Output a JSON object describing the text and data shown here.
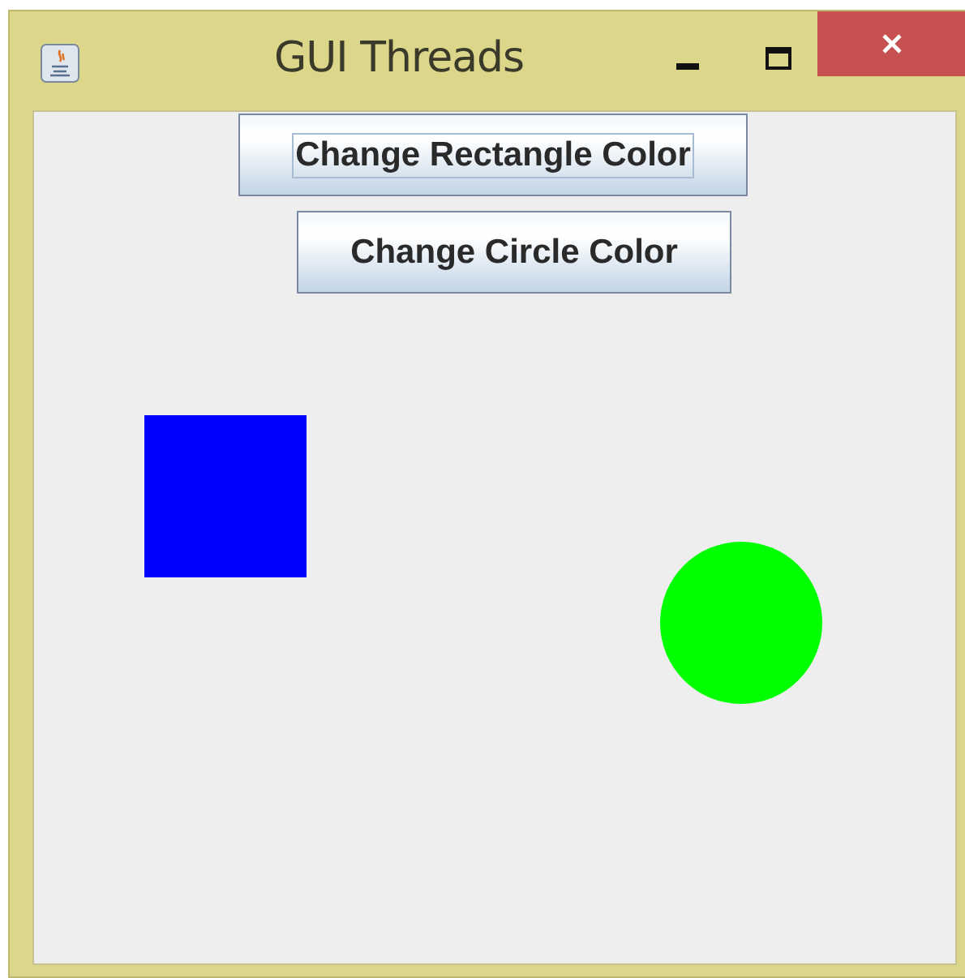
{
  "window": {
    "title": "GUI Threads"
  },
  "buttons": [
    {
      "label": "Change Rectangle Color",
      "focused": true
    },
    {
      "label": "Change Circle Color",
      "focused": false
    }
  ],
  "shapes": [
    {
      "kind": "rectangle",
      "color": "#0000ff"
    },
    {
      "kind": "circle",
      "color": "#00ff00"
    }
  ]
}
